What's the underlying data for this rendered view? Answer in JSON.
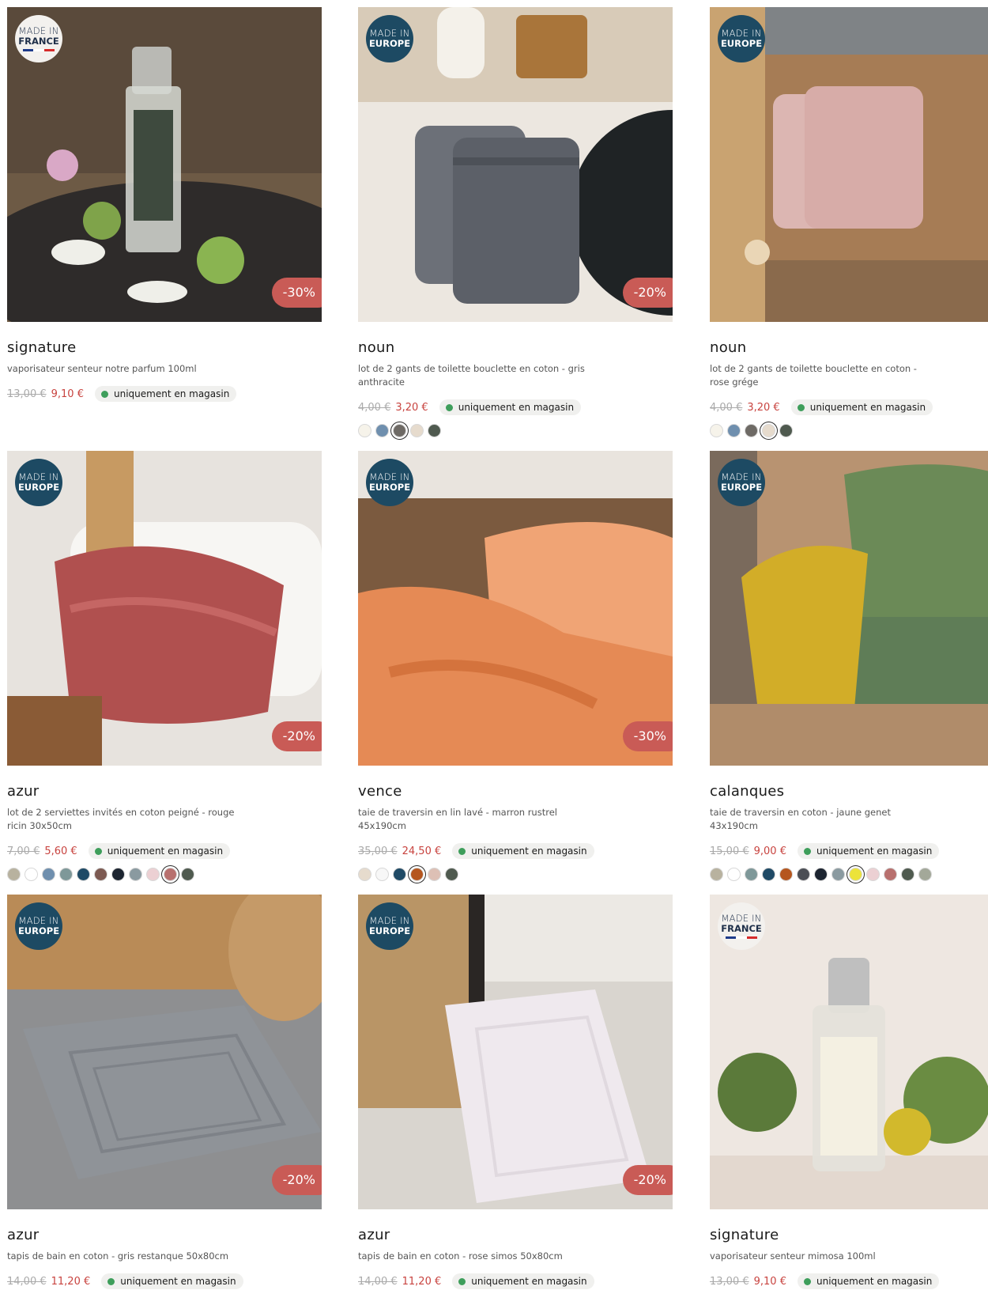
{
  "labels": {
    "availability": "uniquement en magasin",
    "made_in_prefix": "MADE IN",
    "made_in_europe": "EUROPE",
    "made_in_france": "FRANCE"
  },
  "products": [
    {
      "brand": "signature",
      "desc": "vaporisateur senteur notre parfum 100ml",
      "old_price": "13,00 €",
      "new_price": "9,10 €",
      "discount": "-30%",
      "origin": "FRANCE",
      "image": "perfume-bottle-photo",
      "swatches": []
    },
    {
      "brand": "noun",
      "desc": "lot de 2 gants de toilette bouclette en coton - gris anthracite",
      "old_price": "4,00 €",
      "new_price": "3,20 €",
      "discount": "-20%",
      "origin": "EUROPE",
      "image": "grey-washcloths-photo",
      "swatches": [
        "#f6f3ea",
        "#6f8fae",
        "#6e6a65",
        "#e6dbcd",
        "#4f5a4f"
      ],
      "selected": 2
    },
    {
      "brand": "noun",
      "desc": "lot de 2 gants de toilette bouclette en coton - rose grége",
      "old_price": "4,00 €",
      "new_price": "3,20 €",
      "discount": "",
      "origin": "EUROPE",
      "image": "pink-washcloths-photo",
      "swatches": [
        "#f6f3ea",
        "#6f8fae",
        "#6e6a65",
        "#e6dbcd",
        "#4f5a4f"
      ],
      "selected": 3
    },
    {
      "brand": "azur",
      "desc": "lot de 2 serviettes invités en coton peigné - rouge ricin 30x50cm",
      "old_price": "7,00 €",
      "new_price": "5,60 €",
      "discount": "-20%",
      "origin": "EUROPE",
      "image": "red-towel-photo",
      "swatches": [
        "#b8b29f",
        "#ffffff",
        "#6f8fae",
        "#7e9899",
        "#1f4a66",
        "#7d5a52",
        "#1c2430",
        "#8a9aa0",
        "#ecd0d3",
        "#b8706e",
        "#4f5a4f"
      ],
      "selected": 9
    },
    {
      "brand": "vence",
      "desc": "taie de traversin en lin lavé - marron rustrel 45x190cm",
      "old_price": "35,00 €",
      "new_price": "24,50 €",
      "discount": "-30%",
      "origin": "EUROPE",
      "image": "orange-linen-bedding-photo",
      "swatches": [
        "#e6dbcd",
        "#f7f7f7",
        "#1f4a66",
        "#b5561e",
        "#ddc0b5",
        "#4f5a4f"
      ],
      "selected": 3
    },
    {
      "brand": "calanques",
      "desc": "taie de traversin en coton - jaune genet 43x190cm",
      "old_price": "15,00 €",
      "new_price": "9,00 €",
      "discount": "",
      "origin": "EUROPE",
      "image": "yellow-green-bedding-photo",
      "swatches": [
        "#b8b29f",
        "#ffffff",
        "#7e9899",
        "#1f4a66",
        "#b5561e",
        "#4b4e55",
        "#1c2430",
        "#8a9aa0",
        "#ece33a",
        "#ecd0d3",
        "#b8706e",
        "#4f5a4f",
        "#a3a899"
      ],
      "selected": 8
    },
    {
      "brand": "azur",
      "desc": "tapis de bain en coton - gris restanque 50x80cm",
      "old_price": "14,00 €",
      "new_price": "11,20 €",
      "discount": "-20%",
      "origin": "EUROPE",
      "image": "grey-bath-mat-photo",
      "swatches": []
    },
    {
      "brand": "azur",
      "desc": "tapis de bain en coton - rose simos 50x80cm",
      "old_price": "14,00 €",
      "new_price": "11,20 €",
      "discount": "-20%",
      "origin": "EUROPE",
      "image": "pink-bath-mat-photo",
      "swatches": []
    },
    {
      "brand": "signature",
      "desc": "vaporisateur senteur mimosa 100ml",
      "old_price": "13,00 €",
      "new_price": "9,10 €",
      "discount": "",
      "origin": "FRANCE",
      "image": "mimosa-spray-photo",
      "swatches": []
    }
  ],
  "colors": {
    "discount_badge": "#c95b56",
    "new_price": "#c8433f",
    "availability_dot": "#3e9e5b",
    "made_in_europe": "#1d4a63"
  }
}
